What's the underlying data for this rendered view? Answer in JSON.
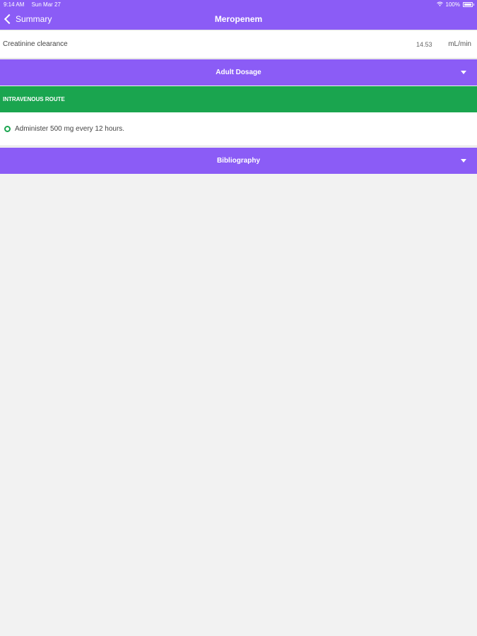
{
  "status_bar": {
    "time": "9:14 AM",
    "date": "Sun Mar 27",
    "battery": "100%"
  },
  "nav": {
    "back_label": "Summary",
    "title": "Meropenem"
  },
  "creatinine": {
    "label": "Creatinine clearance",
    "value": "14.53",
    "unit": "mL/min"
  },
  "sections": {
    "adult_dosage": "Adult Dosage",
    "bibliography": "Bibliography"
  },
  "route": {
    "title": "INTRAVENOUS ROUTE",
    "dose_text": "Administer 500 mg every 12 hours."
  },
  "icons": {
    "back": "chevron-left-icon",
    "expand": "caret-down-icon",
    "bullet": "circle-icon",
    "wifi": "wifi-icon",
    "battery": "battery-icon"
  },
  "colors": {
    "accent": "#8b5cf6",
    "route_green": "#1aa54f",
    "background": "#f2f2f2"
  }
}
